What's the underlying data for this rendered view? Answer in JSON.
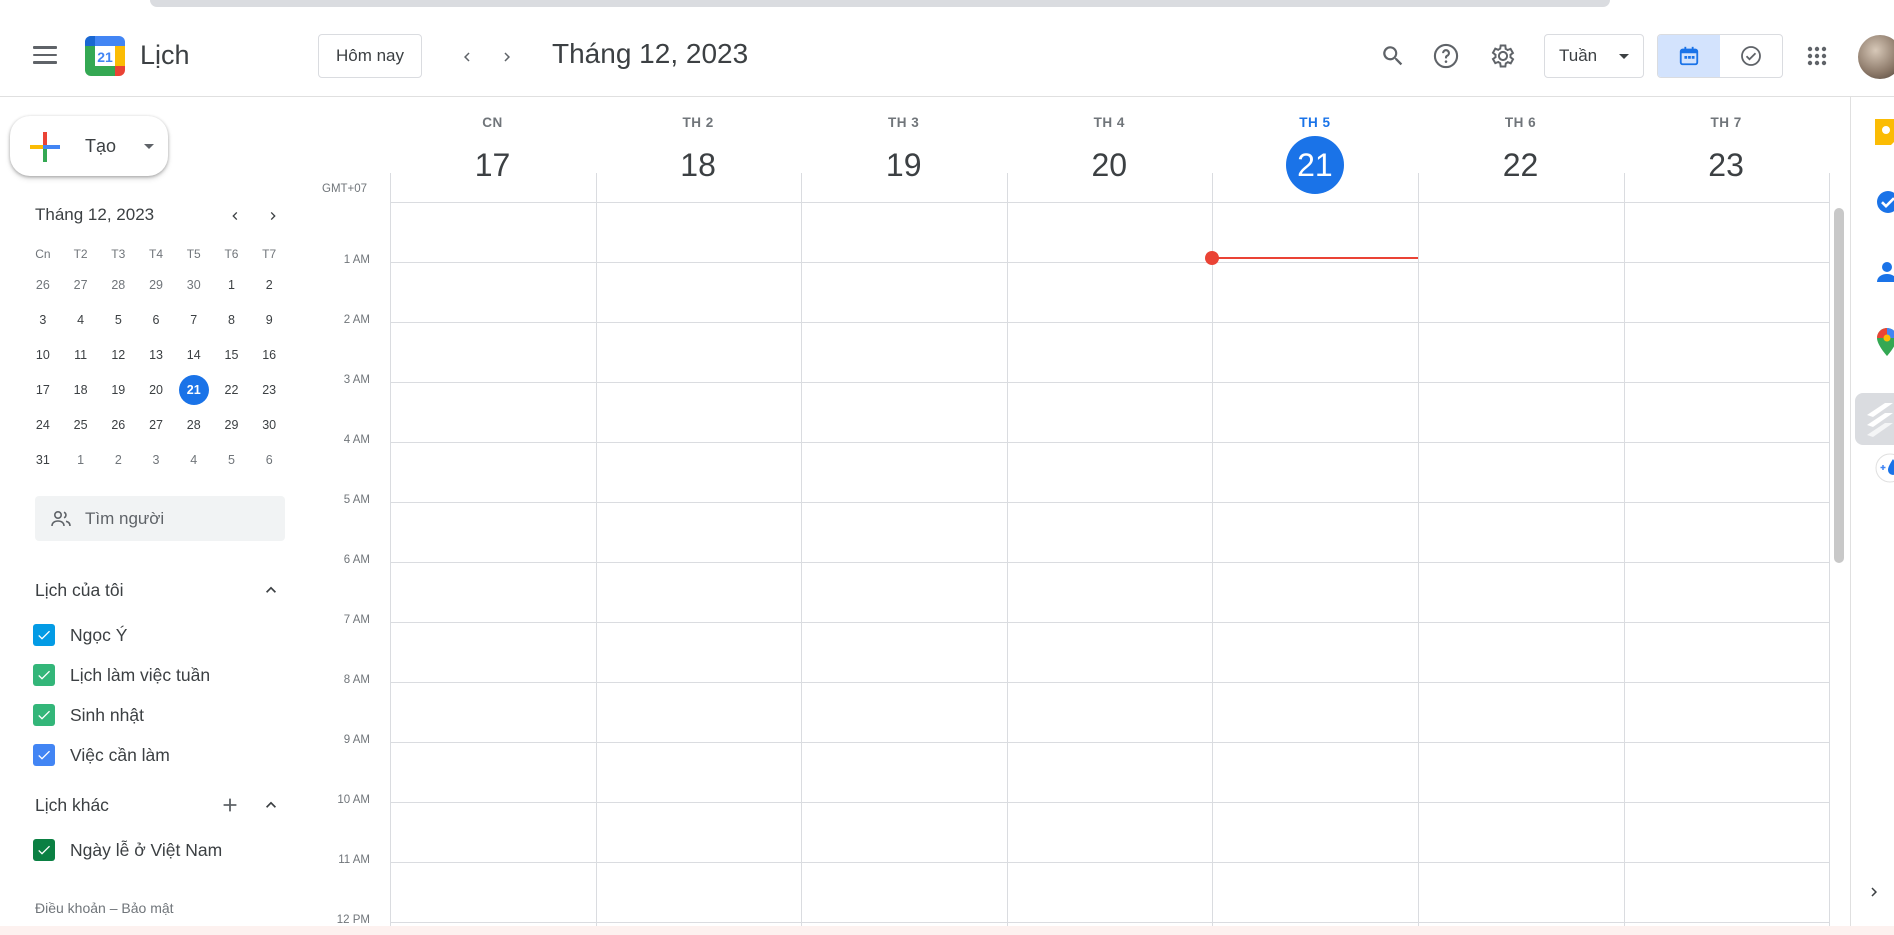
{
  "app": {
    "name": "Lịch",
    "logo_day": "21",
    "colors": {
      "accent": "#1a73e8",
      "now_line": "#ea4335"
    }
  },
  "toolbar": {
    "today_label": "Hôm nay",
    "period_title": "Tháng 12, 2023",
    "view_select": "Tuần",
    "icons": [
      "search-icon",
      "help-icon",
      "gear-icon",
      "calendar-view-icon",
      "tasks-view-icon",
      "apps-grid-icon",
      "avatar"
    ]
  },
  "create": {
    "label": "Tạo"
  },
  "mini_calendar": {
    "title": "Tháng 12, 2023",
    "weekdays": [
      "Cn",
      "T2",
      "T3",
      "T4",
      "T5",
      "T6",
      "T7"
    ],
    "weeks": [
      [
        "26",
        "27",
        "28",
        "29",
        "30",
        "1",
        "2"
      ],
      [
        "3",
        "4",
        "5",
        "6",
        "7",
        "8",
        "9"
      ],
      [
        "10",
        "11",
        "12",
        "13",
        "14",
        "15",
        "16"
      ],
      [
        "17",
        "18",
        "19",
        "20",
        "21",
        "22",
        "23"
      ],
      [
        "24",
        "25",
        "26",
        "27",
        "28",
        "29",
        "30"
      ],
      [
        "31",
        "1",
        "2",
        "3",
        "4",
        "5",
        "6"
      ]
    ],
    "today": "21"
  },
  "search_people": {
    "placeholder": "Tìm người"
  },
  "my_calendars": {
    "title": "Lịch của tôi",
    "items": [
      {
        "label": "Ngọc Ý",
        "color": "#039be5"
      },
      {
        "label": "Lịch làm việc tuần",
        "color": "#33b679"
      },
      {
        "label": "Sinh nhật",
        "color": "#33b679"
      },
      {
        "label": "Việc cần làm",
        "color": "#4285f4"
      }
    ]
  },
  "other_calendars": {
    "title": "Lịch khác",
    "items": [
      {
        "label": "Ngày lễ ở Việt Nam",
        "color": "#0b8043"
      }
    ]
  },
  "footer": {
    "terms": "Điều khoản",
    "separator": " – ",
    "privacy": "Bảo mật"
  },
  "week": {
    "timezone": "GMT+07",
    "days": [
      {
        "name": "CN",
        "date": "17"
      },
      {
        "name": "TH 2",
        "date": "18"
      },
      {
        "name": "TH 3",
        "date": "19"
      },
      {
        "name": "TH 4",
        "date": "20"
      },
      {
        "name": "TH 5",
        "date": "21"
      },
      {
        "name": "TH 6",
        "date": "22"
      },
      {
        "name": "TH 7",
        "date": "23"
      }
    ],
    "today_index": 4,
    "hours": [
      "1 AM",
      "2 AM",
      "3 AM",
      "4 AM",
      "5 AM",
      "6 AM",
      "7 AM",
      "8 AM",
      "9 AM",
      "10 AM",
      "11 AM",
      "12 PM"
    ]
  },
  "side_panel": {
    "icons": [
      "keep-icon",
      "tasks-icon",
      "contacts-icon",
      "maps-icon",
      "addon-icon",
      "weather-addon-icon",
      "expand-panel-icon"
    ]
  }
}
